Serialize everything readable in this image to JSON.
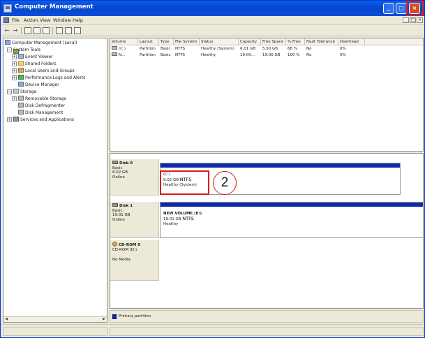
{
  "window": {
    "title": "Computer Management",
    "min_glyph": "_",
    "max_glyph": "□",
    "close_glyph": "×"
  },
  "menu": {
    "items": [
      "File",
      "Action",
      "View",
      "Window",
      "Help"
    ],
    "mdi_min": "_",
    "mdi_max": "□",
    "mdi_close": "×"
  },
  "toolbar": {
    "back": "←",
    "forward": "→",
    "icons": [
      "up-level-icon",
      "show-hide-tree-icon",
      "properties-icon",
      "refresh-icon",
      "help-icon",
      "export-icon"
    ]
  },
  "tree": {
    "items": [
      {
        "label": "Computer Management (Local)",
        "icon": "computer-icon"
      },
      {
        "label": "System Tools",
        "icon": "tools-icon"
      },
      {
        "label": "Event Viewer",
        "icon": "event-viewer-icon"
      },
      {
        "label": "Shared Folders",
        "icon": "shared-folders-icon"
      },
      {
        "label": "Local Users and Groups",
        "icon": "users-icon"
      },
      {
        "label": "Performance Logs and Alerts",
        "icon": "performance-icon"
      },
      {
        "label": "Device Manager",
        "icon": "device-manager-icon"
      },
      {
        "label": "Storage",
        "icon": "storage-icon"
      },
      {
        "label": "Removable Storage",
        "icon": "removable-storage-icon"
      },
      {
        "label": "Disk Defragmenter",
        "icon": "defrag-icon"
      },
      {
        "label": "Disk Management",
        "icon": "disk-management-icon"
      },
      {
        "label": "Services and Applications",
        "icon": "services-icon"
      }
    ],
    "expand_minus": "−",
    "expand_plus": "+",
    "scroll_left": "◀",
    "scroll_right": "▶"
  },
  "volumes": {
    "columns": [
      "Volume",
      "Layout",
      "Type",
      "File System",
      "Status",
      "Capacity",
      "Free Space",
      "% Free",
      "Fault Tolerance",
      "Overhead"
    ],
    "rows": [
      [
        "(C:)",
        "Partition",
        "Basic",
        "NTFS",
        "Healthy (System)",
        "6.01 GB",
        "5.50 GB",
        "68 %",
        "No",
        "0%"
      ],
      [
        "N...",
        "Partition",
        "Basic",
        "NTFS",
        "Healthy",
        "19.00...",
        "19.00 GB",
        "100 %",
        "No",
        "0%"
      ]
    ]
  },
  "disks": [
    {
      "name": "Disk 0",
      "kind": "Basic",
      "size": "8.02 GB",
      "state": "Online",
      "partition": {
        "title": "(C:)",
        "size": "8.02 GB",
        "fs": "NTFS",
        "status": "Healthy (System)"
      }
    },
    {
      "name": "Disk 1",
      "kind": "Basic",
      "size": "19.01 GB",
      "state": "Online",
      "partition": {
        "title": "NEW VOLUME (E:)",
        "size": "19.01 GB",
        "fs": "NTFS",
        "status": "Healthy"
      }
    },
    {
      "name": "CD-ROM 0",
      "kind": "CD-ROM (D:)",
      "size": "",
      "state": "No Media"
    }
  ],
  "callout": {
    "number": "2"
  },
  "legend": {
    "primary_partition": "Primary partition"
  },
  "colors": {
    "titlebar": "#0a5ee8",
    "partition_bar": "#0d2aa8",
    "highlight": "#d81d1b",
    "window_bg": "#ece9d8"
  }
}
